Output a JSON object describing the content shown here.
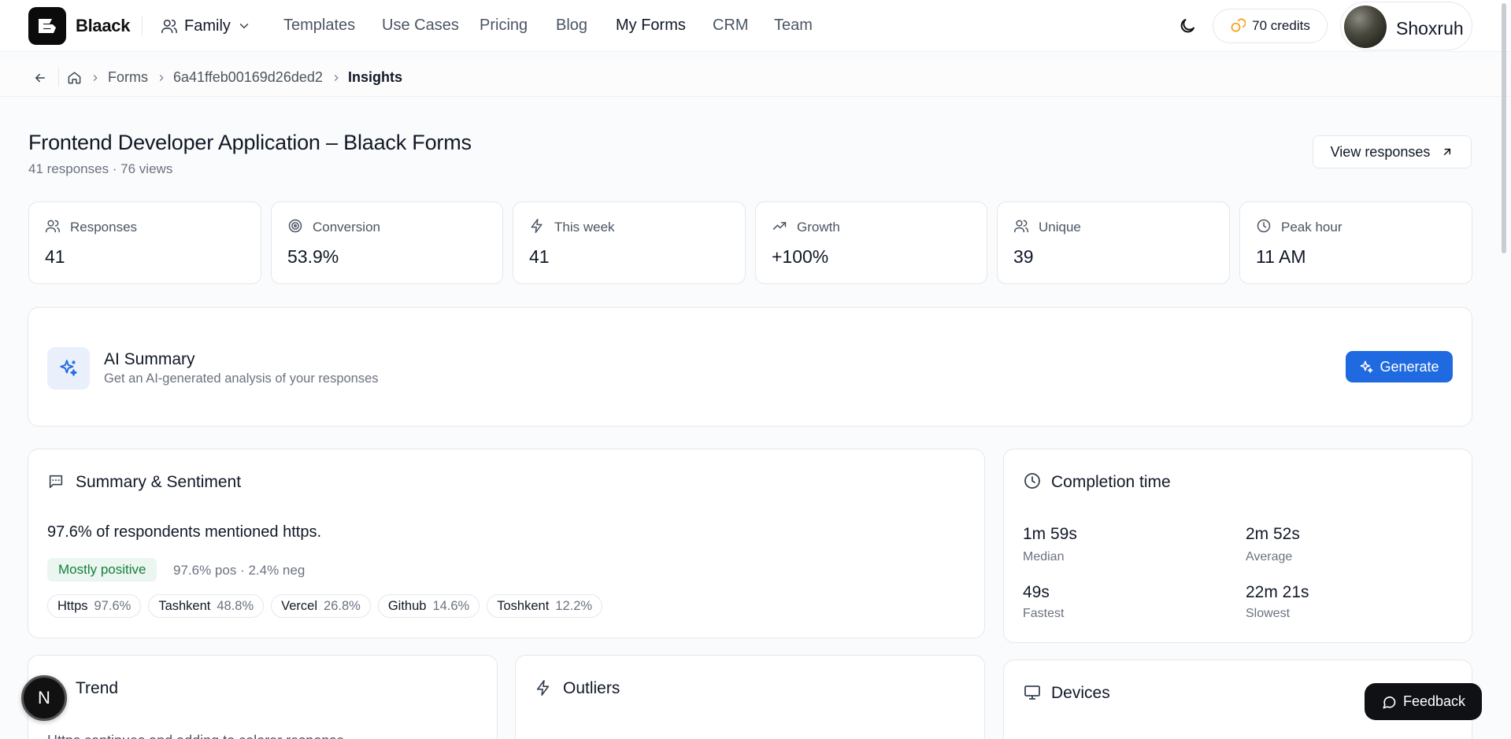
{
  "header": {
    "brand": "Blaack",
    "workspace": "Family",
    "nav": [
      "Templates",
      "Use Cases",
      "Pricing",
      "Blog",
      "My Forms",
      "CRM",
      "Team"
    ],
    "active_nav": "My Forms",
    "credits": "70 credits",
    "user_name": "Shoxruh"
  },
  "breadcrumb": {
    "items": [
      "Forms",
      "6a41ffeb00169d26ded2"
    ],
    "current": "Insights"
  },
  "page": {
    "title": "Frontend Developer Application – Blaack Forms",
    "subtitle": "41 responses · 76 views",
    "view_responses": "View responses"
  },
  "stats": [
    {
      "label": "Responses",
      "value": "41",
      "icon": "users-icon"
    },
    {
      "label": "Conversion",
      "value": "53.9%",
      "icon": "target-icon"
    },
    {
      "label": "This week",
      "value": "41",
      "icon": "bolt-icon"
    },
    {
      "label": "Growth",
      "value": "+100%",
      "icon": "trending-up-icon"
    },
    {
      "label": "Unique",
      "value": "39",
      "icon": "users-icon"
    },
    {
      "label": "Peak hour",
      "value": "11 AM",
      "icon": "clock-icon"
    }
  ],
  "ai_summary": {
    "title": "AI Summary",
    "subtitle": "Get an AI-generated analysis of your responses",
    "button": "Generate"
  },
  "summary_sentiment": {
    "title": "Summary & Sentiment",
    "headline": "97.6% of respondents mentioned https.",
    "badge": "Mostly positive",
    "breakdown": "97.6% pos · 2.4% neg",
    "keywords": [
      {
        "name": "Https",
        "pct": "97.6%"
      },
      {
        "name": "Tashkent",
        "pct": "48.8%"
      },
      {
        "name": "Vercel",
        "pct": "26.8%"
      },
      {
        "name": "Github",
        "pct": "14.6%"
      },
      {
        "name": "Toshkent",
        "pct": "12.2%"
      }
    ]
  },
  "completion_time": {
    "title": "Completion time",
    "items": [
      {
        "value": "1m 59s",
        "label": "Median"
      },
      {
        "value": "2m 52s",
        "label": "Average"
      },
      {
        "value": "49s",
        "label": "Fastest"
      },
      {
        "value": "22m 21s",
        "label": "Slowest"
      }
    ]
  },
  "bottom_cards": {
    "trend": "Trend",
    "trend_text": "Https continues and adding to colorer response",
    "outliers": "Outliers",
    "devices": "Devices"
  },
  "floating": {
    "next_badge": "N",
    "feedback": "Feedback"
  },
  "colors": {
    "accent": "#1f6ae0",
    "positive": "#15803d",
    "positive_bg": "#eaf6ef",
    "credits_icon": "#f59e0b"
  }
}
